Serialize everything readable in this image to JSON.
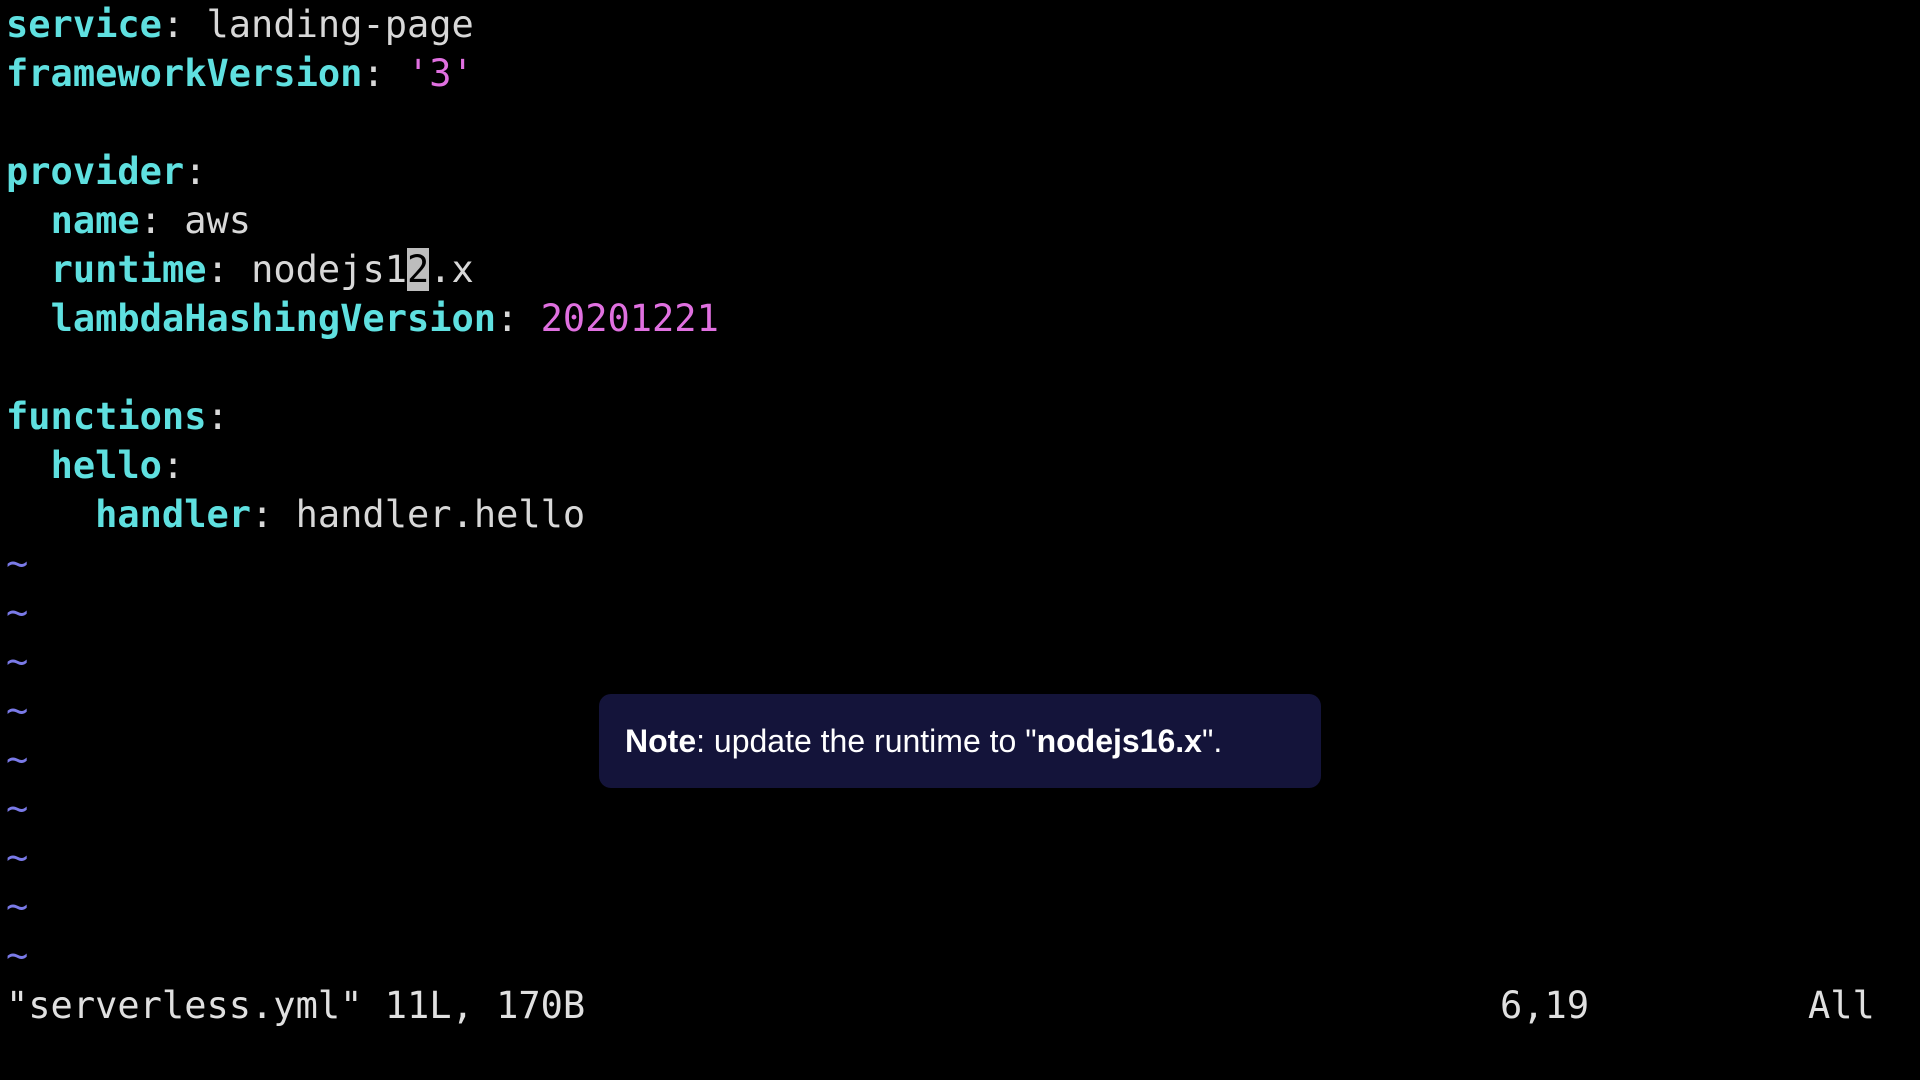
{
  "editor": {
    "lines": [
      {
        "indent": "",
        "key": "service",
        "sep": ": ",
        "value": "landing-page",
        "value_type": "plain"
      },
      {
        "indent": "",
        "key": "frameworkVersion",
        "sep": ": ",
        "value": "'3'",
        "value_type": "string"
      },
      {
        "indent": "",
        "key": "",
        "sep": "",
        "value": "",
        "value_type": "blank"
      },
      {
        "indent": "",
        "key": "provider",
        "sep": ":",
        "value": "",
        "value_type": "none"
      },
      {
        "indent": "  ",
        "key": "name",
        "sep": ": ",
        "value": "aws",
        "value_type": "plain"
      },
      {
        "indent": "  ",
        "key": "runtime",
        "sep": ": ",
        "value_before_cursor": "nodejs1",
        "cursor_char": "2",
        "value_after_cursor": ".x",
        "value_type": "cursor"
      },
      {
        "indent": "  ",
        "key": "lambdaHashingVersion",
        "sep": ": ",
        "value": "20201221",
        "value_type": "number"
      },
      {
        "indent": "",
        "key": "",
        "sep": "",
        "value": "",
        "value_type": "blank"
      },
      {
        "indent": "",
        "key": "functions",
        "sep": ":",
        "value": "",
        "value_type": "none"
      },
      {
        "indent": "  ",
        "key": "hello",
        "sep": ":",
        "value": "",
        "value_type": "none"
      },
      {
        "indent": "    ",
        "key": "handler",
        "sep": ": ",
        "value": "handler.hello",
        "value_type": "plain"
      }
    ],
    "empty_line_marker": "~",
    "empty_line_count": 9
  },
  "statusline": {
    "message": "\"serverless.yml\" 11L, 170B",
    "position": "6,19",
    "scroll": "All"
  },
  "note": {
    "label": "Note",
    "text_before": ": update the runtime to \"",
    "emphasis": "nodejs16.x",
    "text_after": "\"."
  },
  "colors": {
    "background": "#000000",
    "key": "#5fe0e0",
    "value": "#d8d8d8",
    "string": "#e070e0",
    "number": "#e070e0",
    "tilde": "#7a7ae8",
    "cursor": "#bdbdbd",
    "note_background": "#14143a"
  }
}
